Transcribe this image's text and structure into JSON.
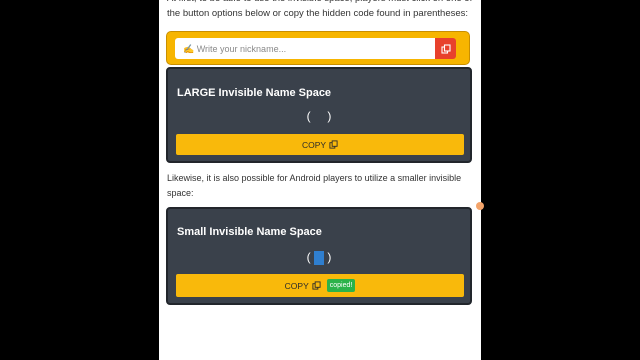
{
  "intro": {
    "text": "At first, to be able to use the invisible space, players must click on one of the button options below or copy the hidden code found in parentheses:"
  },
  "nickname": {
    "placeholder": "✍ Write your nickname...",
    "button_icon": "copy-icon"
  },
  "large_panel": {
    "title": "LARGE Invisible Name Space",
    "open_paren": "(",
    "close_paren": ")",
    "copy_label": "COPY",
    "copy_icon": "copy-icon"
  },
  "middle": {
    "text": "Likewise, it is also possible for Android players to utilize a smaller invisible space:"
  },
  "small_panel": {
    "title": "Small Invisible Name Space",
    "open_paren": "(",
    "close_paren": ")",
    "copy_label": "COPY",
    "copy_icon": "copy-icon",
    "copied_badge": "copied!"
  },
  "colors": {
    "panel_bg": "#3a414b",
    "accent_yellow": "#f9b90b",
    "nick_button": "#e8412c",
    "copied_green": "#2bb34a",
    "selection_blue": "#2f7fd0"
  }
}
